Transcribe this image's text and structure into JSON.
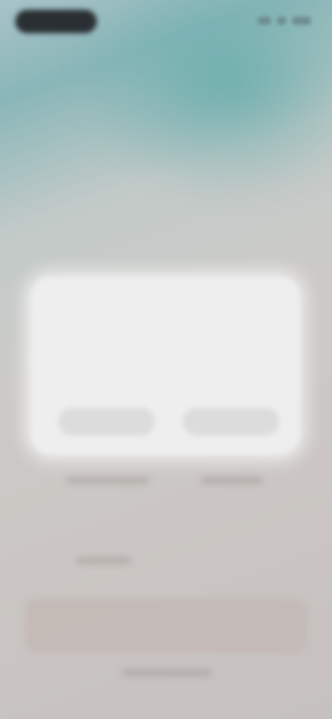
{
  "dialog": {
    "title": "",
    "body": "",
    "secondary_button": "",
    "primary_button": ""
  },
  "background": {
    "bottom_button": ""
  },
  "colors": {
    "teal_accent": "#5ca9a8",
    "dialog_background": "#efeeef",
    "screen_background": "#cbc8c5"
  }
}
